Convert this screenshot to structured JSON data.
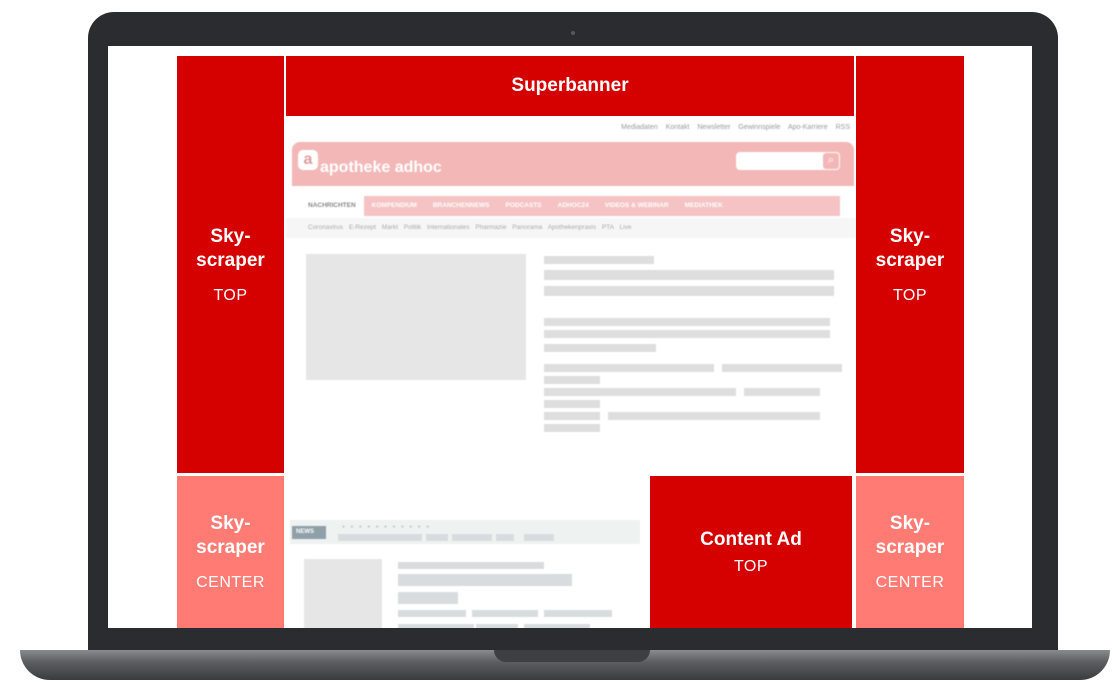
{
  "ads": {
    "superbanner": {
      "title": "Superbanner"
    },
    "sky_left_top": {
      "title": "Sky-\nscraper",
      "sub": "TOP"
    },
    "sky_right_top": {
      "title": "Sky-\nscraper",
      "sub": "TOP"
    },
    "sky_left_center": {
      "title": "Sky-\nscraper",
      "sub": "CENTER"
    },
    "sky_right_center": {
      "title": "Sky-\nscraper",
      "sub": "CENTER"
    },
    "content_ad": {
      "title": "Content Ad",
      "sub": "TOP"
    }
  },
  "site": {
    "meta_links": "Mediadaten Kontakt Newsletter Gewinnspiele Apo-Karriere RSS",
    "logo_letter": "a",
    "logo_text": "apotheke adhoc",
    "nav": [
      "NACHRICHTEN",
      "KOMPENDIUM",
      "BRANCHENNEWS",
      "PODCASTS",
      "ADHOC24",
      "VIDEOS & WEBINAR",
      "MEDIATHEK"
    ],
    "subnav": "Coronavirus E-Rezept Markt Politik Internationales Pharmazie Panorama Apothekenpraxis PTA Live",
    "news_tag": "NEWS"
  },
  "colors": {
    "ad_red": "#d50000",
    "ad_pink": "#ff7b73"
  }
}
